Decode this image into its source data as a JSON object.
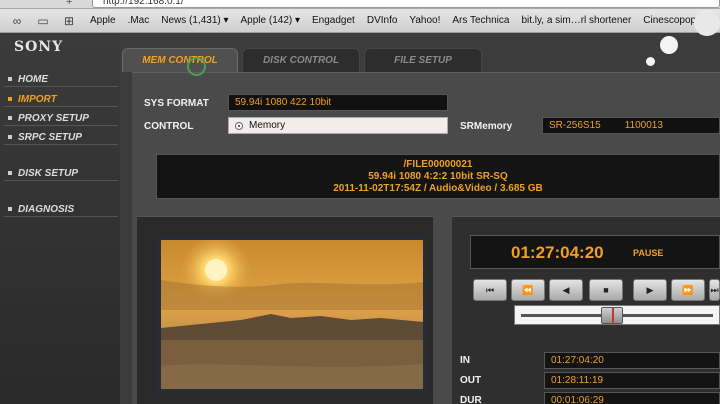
{
  "browser": {
    "url": "http://192.168.0.1/",
    "bookmarks": [
      "Apple",
      ".Mac",
      "News (1,431) ▾",
      "Apple (142) ▾",
      "Engadget",
      "DVInfo",
      "Yahoo!",
      "Ars Technica",
      "bit.ly, a sim…rl shortener",
      "Cinescopophi…"
    ]
  },
  "brand": "SONY",
  "nav": {
    "items": [
      {
        "label": "HOME"
      },
      {
        "label": "IMPORT"
      },
      {
        "label": "PROXY SETUP"
      },
      {
        "label": "SRPC SETUP"
      },
      {
        "label": "DISK SETUP"
      },
      {
        "label": "DIAGNOSIS"
      }
    ],
    "active_label": "IMPORT"
  },
  "tabs": [
    {
      "label": "MEM CONTROL"
    },
    {
      "label": "DISK CONTROL"
    },
    {
      "label": "FILE SETUP"
    }
  ],
  "active_tab": "MEM CONTROL",
  "fields": {
    "sys_format_label": "SYS FORMAT",
    "sys_format_value": "59.94i 1080 422 10bit",
    "control_label": "CONTROL",
    "control_value": "Memory",
    "srmemory_label": "SRMemory",
    "srmemory_model": "SR-256S15",
    "srmemory_id": "1100013"
  },
  "file_info": {
    "name": "/FILE00000021",
    "format": "59.94i 1080 4:2:2 10bit SR-SQ",
    "details": "2011-11-02T17:54Z / Audio&Video / 3.685 GB"
  },
  "transport": {
    "timecode": "01:27:04:20",
    "state": "PAUSE",
    "buttons": [
      "⏮",
      "⏪",
      "◀",
      "■",
      "▶",
      "⏩",
      "⏭"
    ],
    "position": 0.47
  },
  "in_out": {
    "in_label": "IN",
    "in_value": "01:27:04:20",
    "out_label": "OUT",
    "out_value": "01:28:11:19",
    "dur_label": "DUR",
    "dur_value": "00:01:06:29"
  },
  "colors": {
    "accent": "#f0a020",
    "panel": "#4a4a4a",
    "field_bg": "#141414"
  }
}
